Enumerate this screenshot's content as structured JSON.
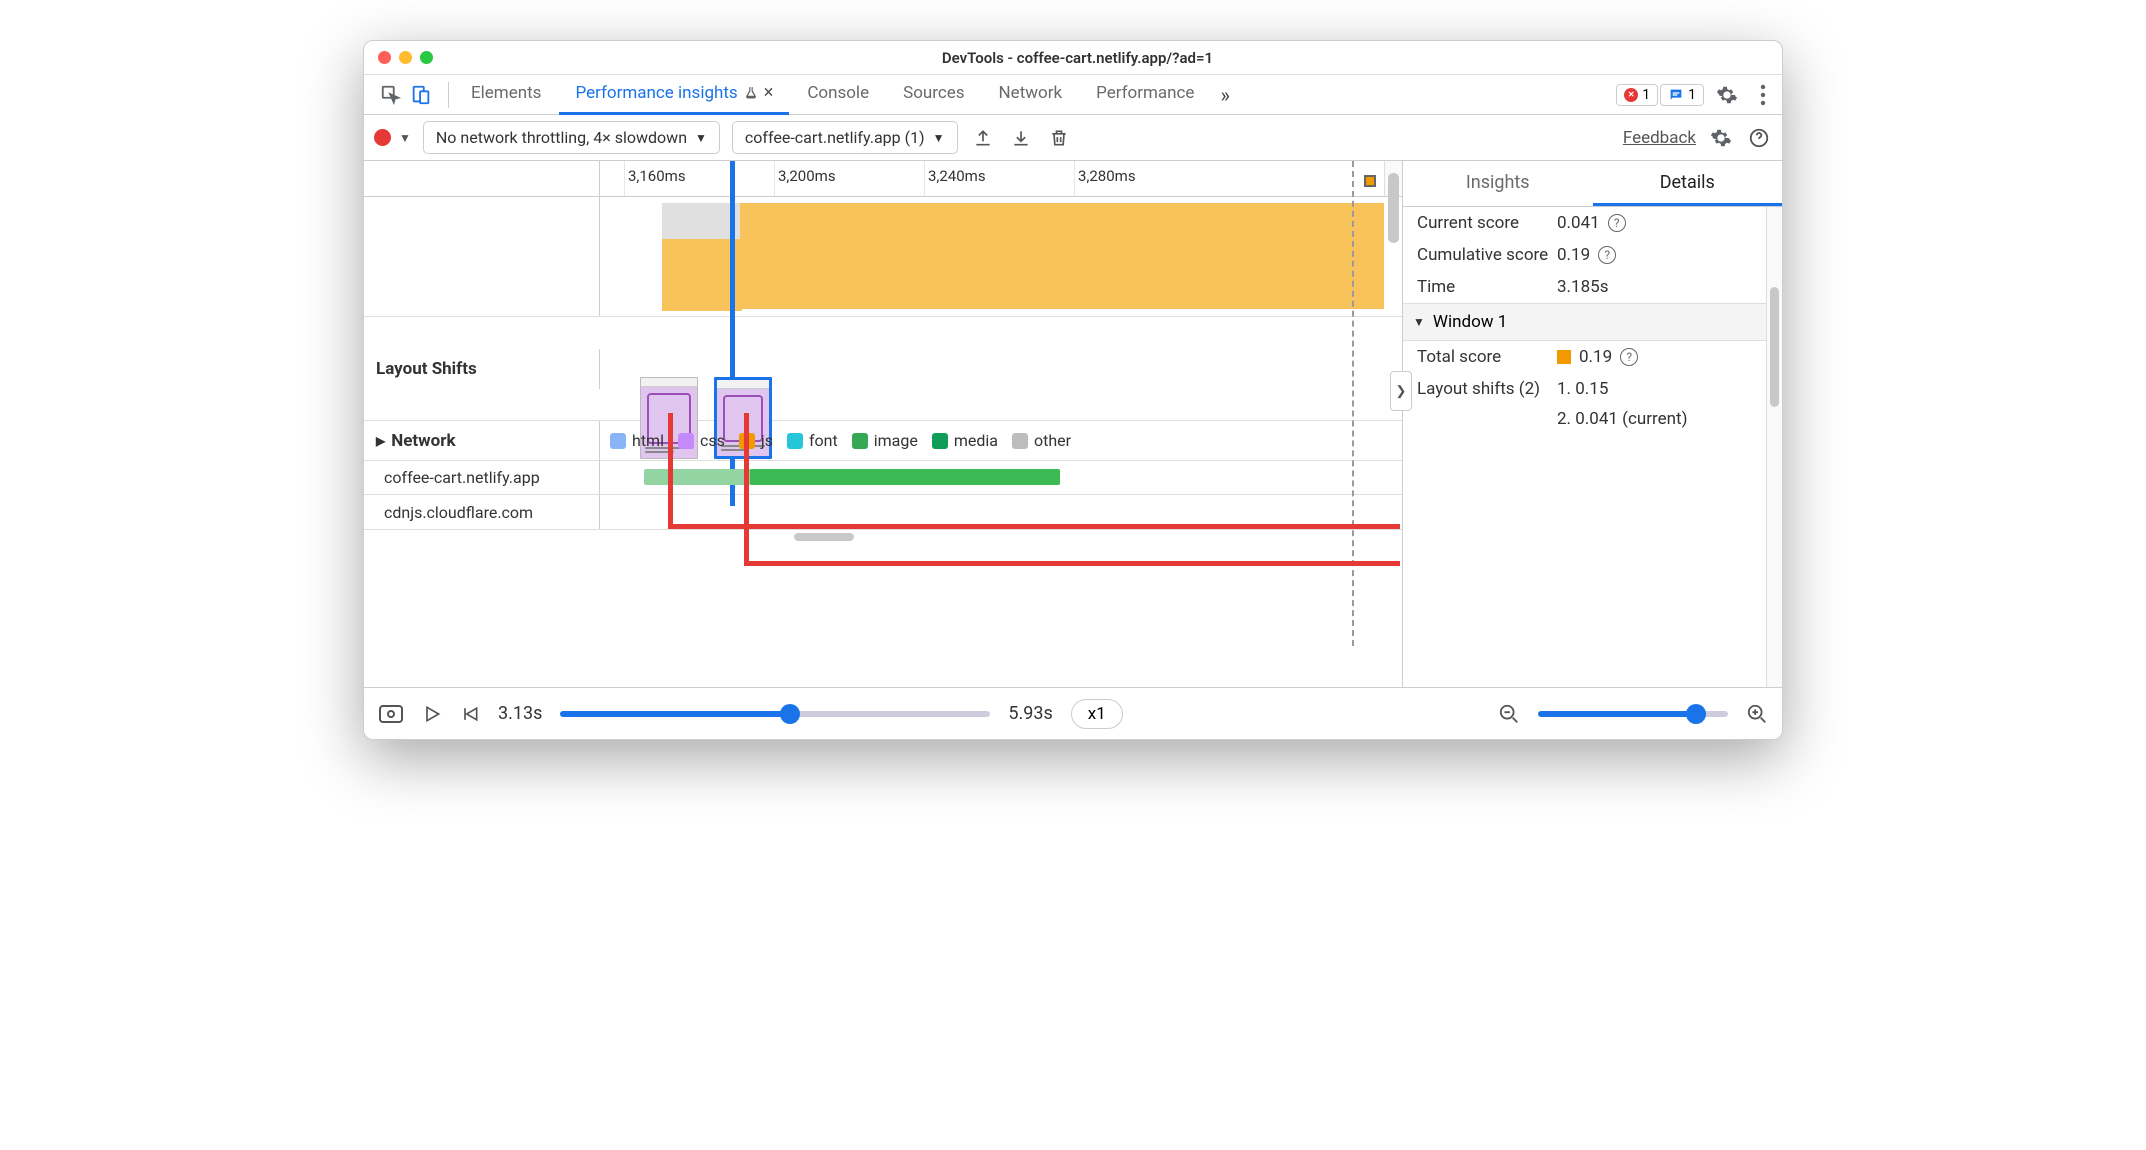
{
  "window": {
    "title": "DevTools - coffee-cart.netlify.app/?ad=1"
  },
  "tabs": {
    "elements": "Elements",
    "perf_insights": "Performance insights",
    "console": "Console",
    "sources": "Sources",
    "network": "Network",
    "performance": "Performance"
  },
  "badges": {
    "errors": "1",
    "messages": "1"
  },
  "toolbar2": {
    "throttling": "No network throttling, 4× slowdown",
    "recording": "coffee-cart.netlify.app (1)",
    "feedback": "Feedback"
  },
  "ruler": {
    "t0": "3,160ms",
    "t1": "3,200ms",
    "t2": "3,240ms",
    "t3": "3,280ms"
  },
  "tracks": {
    "layout_shifts": "Layout Shifts",
    "network": "Network"
  },
  "legend": {
    "html": "html",
    "css": "css",
    "js": "js",
    "font": "font",
    "image": "image",
    "media": "media",
    "other": "other"
  },
  "legend_colors": {
    "html": "#8ab4f8",
    "css": "#c58af9",
    "js": "#f29900",
    "font": "#26c6da",
    "image": "#34a853",
    "media": "#0f9d58",
    "other": "#bdbdbd"
  },
  "hosts": {
    "h1": "coffee-cart.netlify.app",
    "h2": "cdnjs.cloudflare.com"
  },
  "details": {
    "tab_insights": "Insights",
    "tab_details": "Details",
    "current_score_label": "Current score",
    "current_score": "0.041",
    "cumulative_label": "Cumulative score",
    "cumulative": "0.19",
    "time_label": "Time",
    "time": "3.185s",
    "window_label": "Window 1",
    "total_score_label": "Total score",
    "total_score": "0.19",
    "shifts_label": "Layout shifts (2)",
    "shift1": "1. 0.15",
    "shift2": "2. 0.041 (current)"
  },
  "bottom": {
    "start": "3.13s",
    "end": "5.93s",
    "speed": "x1"
  }
}
